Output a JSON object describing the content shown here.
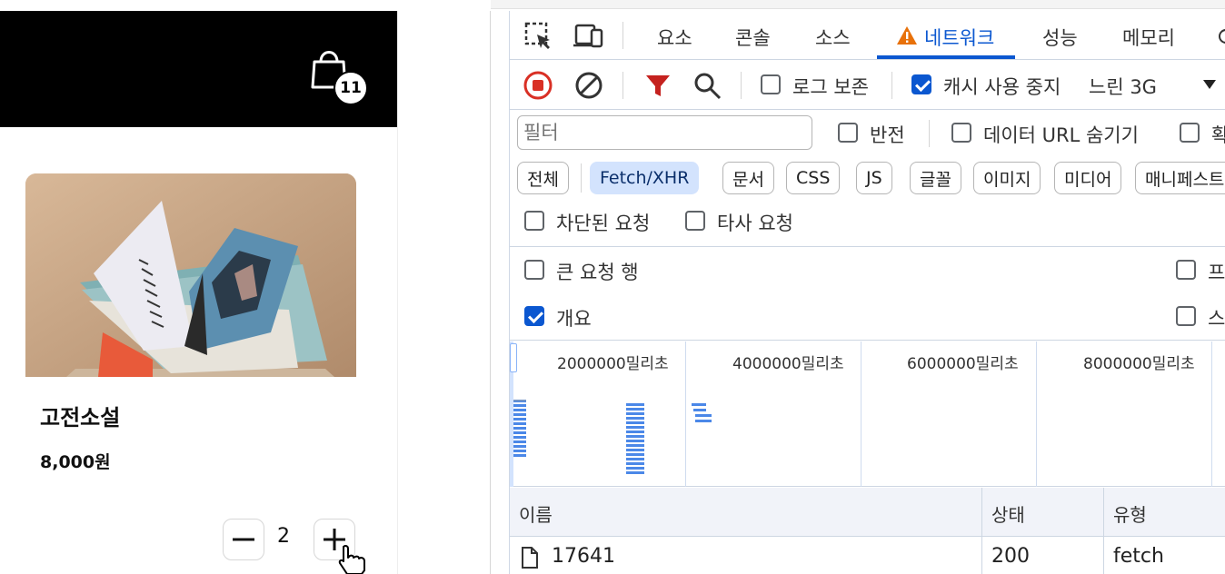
{
  "shop": {
    "cart_count": "11",
    "product": {
      "title": "고전소설",
      "price": "8,000원",
      "quantity": "2",
      "image_icon": "open-book-photo"
    }
  },
  "devtools": {
    "tabs": [
      {
        "label": "요소"
      },
      {
        "label": "콘솔"
      },
      {
        "label": "소스"
      },
      {
        "label": "네트워크",
        "active": true,
        "warning": true
      },
      {
        "label": "성능"
      },
      {
        "label": "메모리"
      }
    ],
    "toolbar": {
      "preserve_log": {
        "label": "로그 보존",
        "checked": false
      },
      "disable_cache": {
        "label": "캐시 사용 중지",
        "checked": true
      },
      "throttling": "느린 3G"
    },
    "filter": {
      "placeholder": "필터",
      "invert": {
        "label": "반전",
        "checked": false
      },
      "hide_data_urls": {
        "label": "데이터 URL 숨기기",
        "checked": false
      },
      "extra_label": "확"
    },
    "type_chips": [
      {
        "label": "전체",
        "selected": false
      },
      {
        "label": "Fetch/XHR",
        "selected": true
      },
      {
        "label": "문서",
        "selected": false
      },
      {
        "label": "CSS",
        "selected": false
      },
      {
        "label": "JS",
        "selected": false
      },
      {
        "label": "글꼴",
        "selected": false
      },
      {
        "label": "이미지",
        "selected": false
      },
      {
        "label": "미디어",
        "selected": false
      },
      {
        "label": "매니페스트",
        "selected": false
      }
    ],
    "blocked_requests": {
      "label": "차단된 요청",
      "checked": false
    },
    "third_party": {
      "label": "타사 요청",
      "checked": false
    },
    "settings": {
      "big_rows": {
        "label": "큰 요청 행",
        "checked": false
      },
      "overview": {
        "label": "개요",
        "checked": true
      },
      "right_top": {
        "label": "프",
        "checked": false
      },
      "right_bottom": {
        "label": "스",
        "checked": false
      }
    },
    "overview_ticks": [
      "2000000밀리초",
      "4000000밀리초",
      "6000000밀리초",
      "8000000밀리초"
    ],
    "table": {
      "columns": [
        "이름",
        "상태",
        "유형"
      ],
      "rows": [
        {
          "name": "17641",
          "status": "200",
          "type": "fetch"
        }
      ]
    }
  },
  "colors": {
    "accent": "#0b57d0",
    "record": "#d93025",
    "filter_funnel": "#c5221f",
    "warning": "#e8710a",
    "bars": "#4b88e8"
  }
}
